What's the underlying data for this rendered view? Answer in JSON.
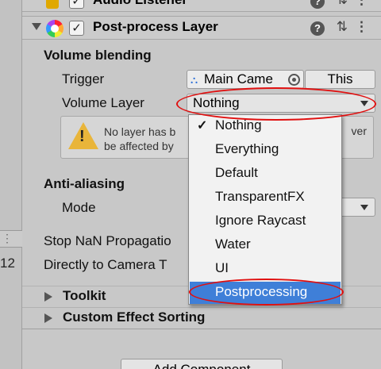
{
  "audio_listener": {
    "title": "Audio Listener"
  },
  "post_process_layer": {
    "title": "Post-process Layer",
    "enabled_mark": "✓",
    "help_icon": "?",
    "settings_icon": "⇅",
    "more_icon": "⋮"
  },
  "volume_blending": {
    "section": "Volume blending",
    "trigger_label": "Trigger",
    "trigger_value": "Main Came",
    "this_button": "This",
    "volume_layer_label": "Volume Layer",
    "volume_layer_value": "Nothing",
    "warning_line1": "No layer has b",
    "warning_line2": "be affected by",
    "warning_tail": "ver"
  },
  "anti_aliasing": {
    "section": "Anti-aliasing",
    "mode_label": "Mode"
  },
  "options": {
    "stop_nan": "Stop NaN Propagatio",
    "directly_to_camera": "Directly to Camera T"
  },
  "foldouts": {
    "toolkit": "Toolkit",
    "custom_effect_sorting": "Custom Effect Sorting"
  },
  "add_component": "Add Component",
  "left_pane": {
    "num": "12",
    "dots": "⋮"
  },
  "dropdown_menu": {
    "selected_mark": "✓",
    "items": [
      "Nothing",
      "Everything",
      "Default",
      "TransparentFX",
      "Ignore Raycast",
      "Water",
      "UI",
      "Postprocessing"
    ],
    "selected": "Nothing",
    "highlighted": "Postprocessing"
  },
  "colors": {
    "highlight": "#3f7fd8",
    "annotation": "#e01010",
    "warning": "#e9b53a"
  }
}
